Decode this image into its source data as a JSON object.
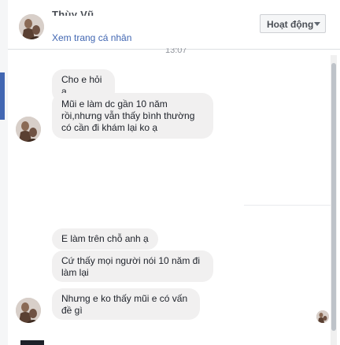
{
  "header": {
    "name": "Thùy Vũ",
    "profile_link": "Xem trang cá nhân",
    "status_button": "Hoạt động"
  },
  "timestamp": "13:07",
  "messages": [
    {
      "text": "Cho e hỏi ạ"
    },
    {
      "text": "Mũi e làm dc gần 10 năm rồi,nhưng vẫn thấy bình thường có cần đi khám lại ko ạ"
    },
    {
      "text": "E làm trên chỗ anh ạ"
    },
    {
      "text": "Cứ thấy mọi người nói 10 năm đi làm lại"
    },
    {
      "text": "Nhưng e ko thấy mũi e có vấn đề gì"
    }
  ],
  "icons": {
    "status_caret": "chevron-down-icon",
    "avatar": "user-photo"
  },
  "colors": {
    "link": "#4267b2",
    "bubble": "#f1f0f0",
    "accent_strip": "#4267b2"
  }
}
